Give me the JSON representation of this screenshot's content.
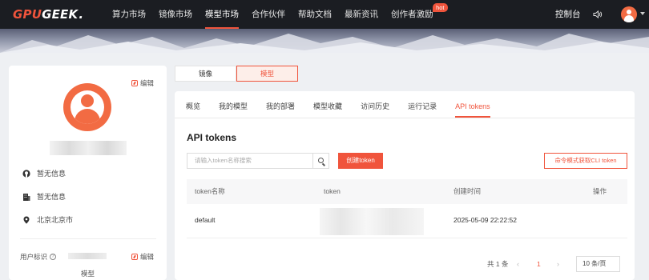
{
  "header": {
    "logo_gpu": "GPU",
    "logo_geek": "GEEK",
    "logo_dot": ".",
    "nav": [
      {
        "label": "算力市场",
        "active": false
      },
      {
        "label": "镜像市场",
        "active": false
      },
      {
        "label": "模型市场",
        "active": true
      },
      {
        "label": "合作伙伴",
        "active": false
      },
      {
        "label": "帮助文档",
        "active": false
      },
      {
        "label": "最新资讯",
        "active": false
      },
      {
        "label": "创作者激励",
        "active": false,
        "badge": "hot"
      }
    ],
    "console_label": "控制台"
  },
  "profile": {
    "edit_label": "编辑",
    "github": "暂无信息",
    "company": "暂无信息",
    "location": "北京北京市",
    "uid_label": "用户标识",
    "uid_edit": "编辑",
    "model_label": "模型"
  },
  "toggle": [
    {
      "label": "镜像",
      "active": false
    },
    {
      "label": "模型",
      "active": true
    }
  ],
  "tabs": [
    {
      "label": "概览",
      "active": false
    },
    {
      "label": "我的模型",
      "active": false
    },
    {
      "label": "我的部署",
      "active": false
    },
    {
      "label": "模型收藏",
      "active": false
    },
    {
      "label": "访问历史",
      "active": false
    },
    {
      "label": "运行记录",
      "active": false
    },
    {
      "label": "API tokens",
      "active": true
    }
  ],
  "section": {
    "title": "API tokens",
    "search_placeholder": "请输入token名称搜索",
    "create_label": "创建token",
    "cli_label": "命令模式获取CLI token"
  },
  "table": {
    "columns": [
      "token名称",
      "token",
      "创建时间",
      "操作"
    ],
    "rows": [
      {
        "name": "default",
        "token": "",
        "created": "2025-05-09 22:22:52",
        "action": ""
      }
    ]
  },
  "pagination": {
    "total": "共 1 条",
    "current_page": "1",
    "page_size": "10 条/页"
  },
  "colors": {
    "accent": "#f0543c",
    "nav_bg": "#1b1d22",
    "page_bg": "#eef0f3"
  }
}
